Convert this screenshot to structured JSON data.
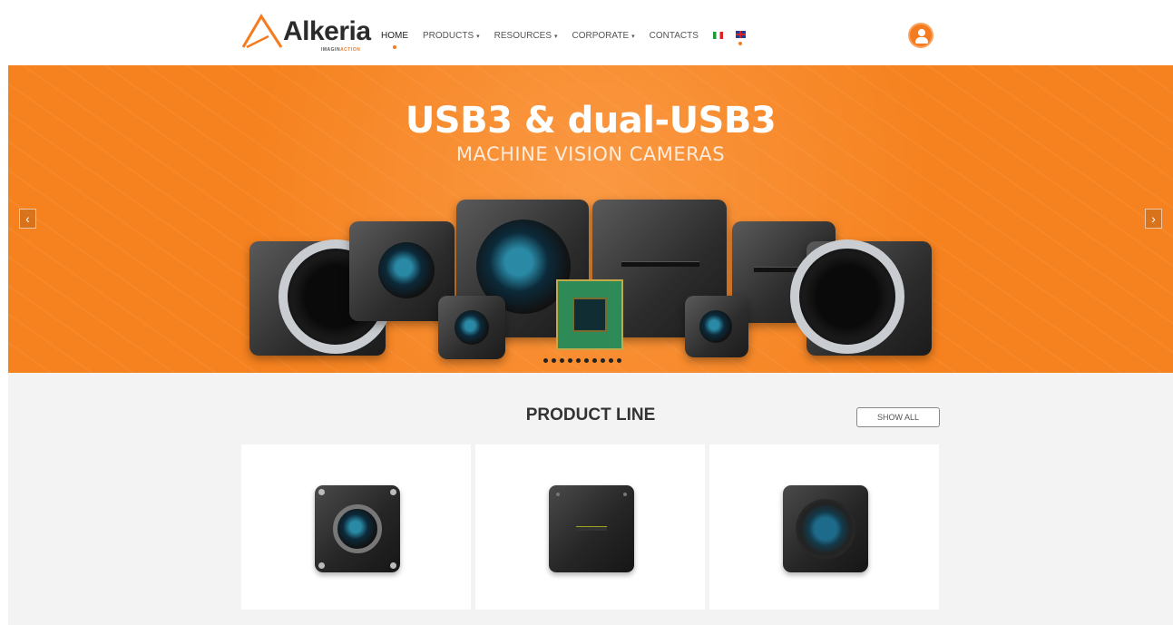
{
  "header": {
    "logo_text": "Alkeria",
    "logo_tagline": "IMAGIN",
    "logo_tagline_accent": "ACTION",
    "nav": [
      {
        "label": "HOME",
        "active": true,
        "dropdown": false
      },
      {
        "label": "PRODUCTS",
        "active": false,
        "dropdown": true
      },
      {
        "label": "RESOURCES",
        "active": false,
        "dropdown": true
      },
      {
        "label": "CORPORATE",
        "active": false,
        "dropdown": true
      },
      {
        "label": "CONTACTS",
        "active": false,
        "dropdown": false
      }
    ],
    "languages": [
      {
        "code": "it",
        "icon": "italy-flag-icon",
        "selected": false
      },
      {
        "code": "en",
        "icon": "uk-flag-icon",
        "selected": true
      }
    ],
    "user_icon": "user-icon",
    "caret": "▾"
  },
  "hero": {
    "title": "USB3 & dual-USB3",
    "subtitle": "MACHINE VISION CAMERAS",
    "prev_icon": "chevron-left-icon",
    "next_icon": "chevron-right-icon",
    "prev_glyph": "‹",
    "next_glyph": "›",
    "slide_count": 10,
    "background_color": "#f6821f"
  },
  "product_line": {
    "title": "PRODUCT LINE",
    "show_all_label": "SHOW ALL",
    "cards": [
      {
        "image": "camera-lens-front"
      },
      {
        "image": "camera-line-scan-slit"
      },
      {
        "image": "camera-sensor-front"
      }
    ]
  },
  "colors": {
    "accent": "#f47b20",
    "section_bg": "#f3f3f3"
  }
}
